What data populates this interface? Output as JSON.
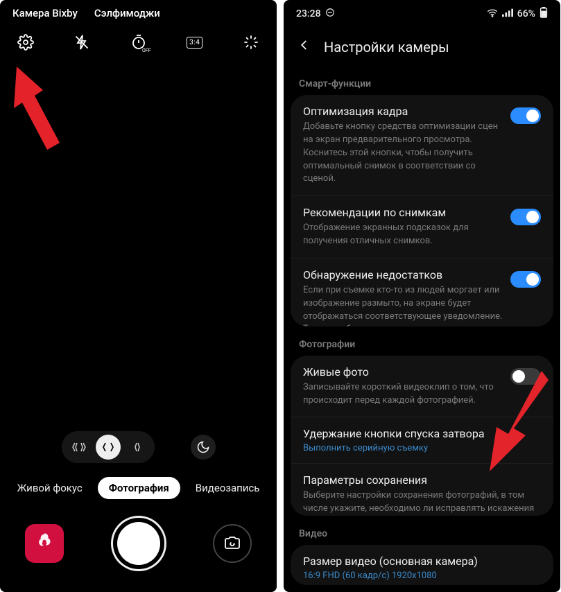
{
  "camera": {
    "top_tabs": [
      "Камера Bixby",
      "Сэлфимоджи"
    ],
    "toolbar_icons": {
      "settings": "gear",
      "flash": "flash-off",
      "timer": "timer-off",
      "aspect": "3:4",
      "effects": "magic"
    },
    "lens": {
      "wide": "wide",
      "normal": "1x",
      "tele": "tele"
    },
    "modes": {
      "left": "Живой фокус",
      "center": "Фотография",
      "right": "Видеозапись"
    }
  },
  "status": {
    "time": "23:28",
    "battery_label": "66%"
  },
  "settings": {
    "title": "Настройки камеры",
    "section_smart": "Смарт-функции",
    "smart": [
      {
        "title": "Оптимизация кадра",
        "desc": "Добавьте кнопку средства оптимизации сцен на экран предварительного просмотра. Коснитесь этой кнопки, чтобы получить оптимальный снимок в соответствии со сценой.",
        "on": true
      },
      {
        "title": "Рекомендации по снимкам",
        "desc": "Отображение экранных подсказок для получения отличных снимков.",
        "on": true
      },
      {
        "title": "Обнаружение недостатков",
        "desc": "Если при съемке кто-то из людей моргает или изображение размыто, на экране будет отображаться соответствующее уведомление. Также вы будете получать уведомления о загрязнении объектива камеры.",
        "on": true
      }
    ],
    "section_photos": "Фотографии",
    "photos": [
      {
        "title": "Живые фото",
        "desc": "Записывайте короткий видеоклип о том, что происходит перед каждой фотографией.",
        "on": false
      },
      {
        "title": "Удержание кнопки спуска затвора",
        "link": "Выполнить серийную съемку"
      },
      {
        "title": "Параметры сохранения",
        "desc": "Выберите настройки сохранения фотографий, в том числе укажите, необходимо ли исправлять искажения и зеркально отражать селфи."
      }
    ],
    "section_video": "Видео",
    "video": {
      "title": "Размер видео (основная камера)",
      "link": "16:9 FHD (60 кадр/с) 1920x1080"
    }
  }
}
